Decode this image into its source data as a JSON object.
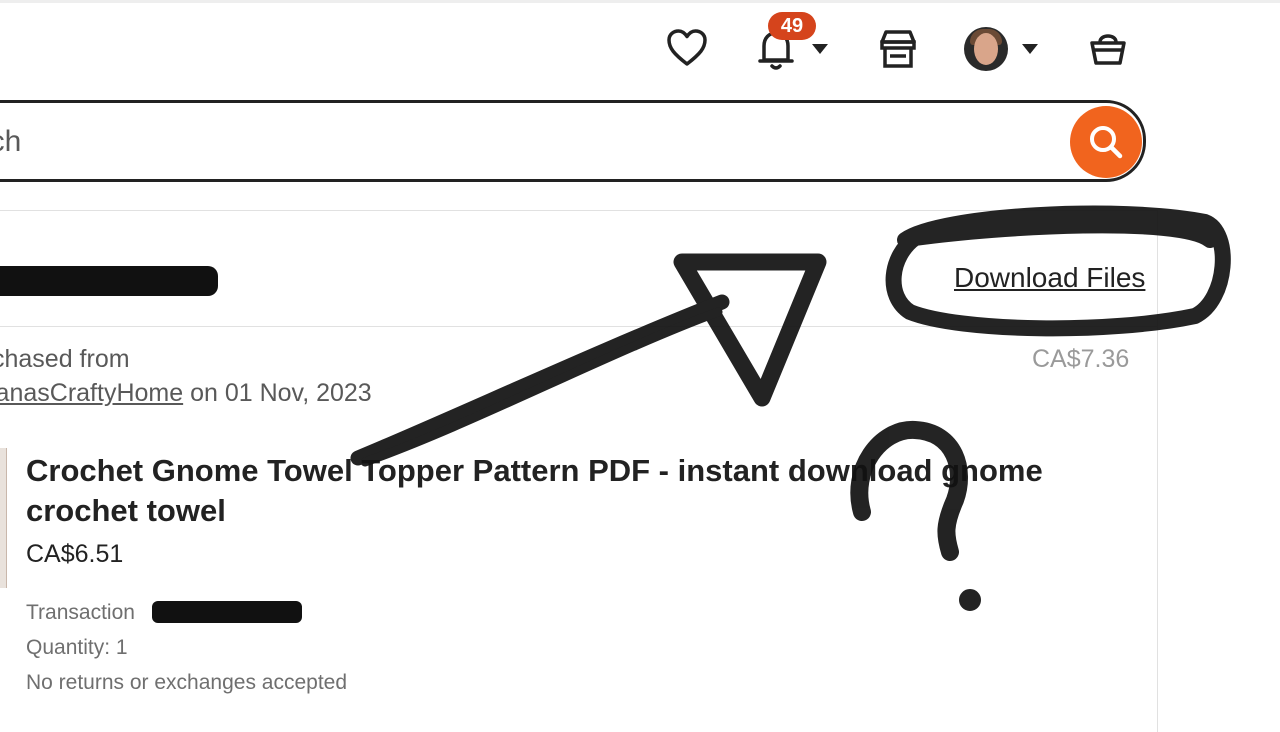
{
  "header": {
    "notification_count": "49",
    "icons": [
      "heart-icon",
      "bell-icon",
      "shop-icon",
      "avatar",
      "basket-icon"
    ]
  },
  "search": {
    "placeholder_visible": "arch"
  },
  "order": {
    "download_link": "Download Files",
    "purchased_from_label": "chased from",
    "shop_name": "lanasCraftyHome",
    "date_text": " on 01 Nov, 2023",
    "total": "CA$7.36"
  },
  "item": {
    "title": "Crochet Gnome Towel Topper Pattern PDF - instant download gnome crochet towel",
    "price": "CA$6.51",
    "transaction_label": "Transaction",
    "quantity": "Quantity: 1",
    "returns": "No returns or exchanges accepted"
  },
  "colors": {
    "accent": "#f1641e",
    "badge": "#d5441c",
    "annotation": "#111111"
  }
}
